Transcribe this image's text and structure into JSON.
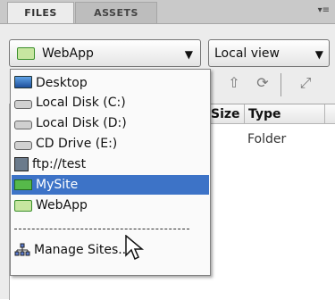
{
  "tabs": [
    {
      "label": "FILES",
      "active": true
    },
    {
      "label": "ASSETS",
      "active": false
    }
  ],
  "panel_menu_icon": "panel-menu-icon",
  "site_select": {
    "value": "WebApp",
    "icon": "site-folder-icon"
  },
  "view_select": {
    "value": "Local view"
  },
  "columns": {
    "size": "Size",
    "type": "Type"
  },
  "rows": [
    {
      "type": "Folder"
    }
  ],
  "menu": {
    "items": [
      {
        "label": "Desktop",
        "icon": "desktop-icon"
      },
      {
        "label": "Local Disk (C:)",
        "icon": "local-disk-c-icon"
      },
      {
        "label": "Local Disk (D:)",
        "icon": "local-disk-d-icon"
      },
      {
        "label": "CD Drive (E:)",
        "icon": "cd-drive-icon"
      },
      {
        "label": "ftp://test",
        "icon": "ftp-server-icon"
      },
      {
        "label": "MySite",
        "icon": "site-icon",
        "selected": true
      },
      {
        "label": "WebApp",
        "icon": "site-folder-icon"
      },
      {
        "label": "Manage Sites...",
        "icon": "manage-sites-icon"
      }
    ],
    "selected_color": "#3d73c7"
  }
}
